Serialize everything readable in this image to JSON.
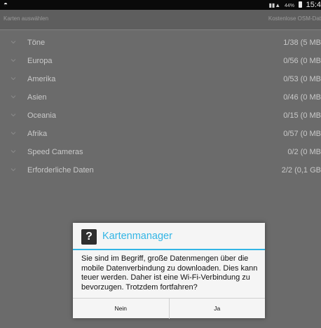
{
  "status_bar": {
    "left_icon": "sync-icon",
    "signal_icon": "signal-icon",
    "battery_percent": "44%",
    "time": "15:4"
  },
  "header": {
    "left": "Karten auswählen",
    "right": "Kostenlose OSM-Dat"
  },
  "list": {
    "items": [
      {
        "name": "Töne",
        "size": "1/38 (5 MB"
      },
      {
        "name": "Europa",
        "size": "0/56 (0 MB"
      },
      {
        "name": "Amerika",
        "size": "0/53 (0 MB"
      },
      {
        "name": "Asien",
        "size": "0/46 (0 MB"
      },
      {
        "name": "Oceania",
        "size": "0/15 (0 MB"
      },
      {
        "name": "Afrika",
        "size": "0/57 (0 MB"
      },
      {
        "name": "Speed Cameras",
        "size": "0/2 (0 MB"
      },
      {
        "name": "Erforderliche Daten",
        "size": "2/2 (0,1 GB"
      }
    ]
  },
  "dialog": {
    "icon": "question-mark-icon",
    "title": "Kartenmanager",
    "message": "Sie sind im Begriff, große Datenmengen über die mobile Datenverbindung zu downloaden. Dies kann teuer werden. Daher ist eine Wi-Fi-Verbindung zu bevorzugen. Trotzdem fortfahren?",
    "no_label": "Nein",
    "yes_label": "Ja",
    "accent_color": "#33b5e5"
  }
}
